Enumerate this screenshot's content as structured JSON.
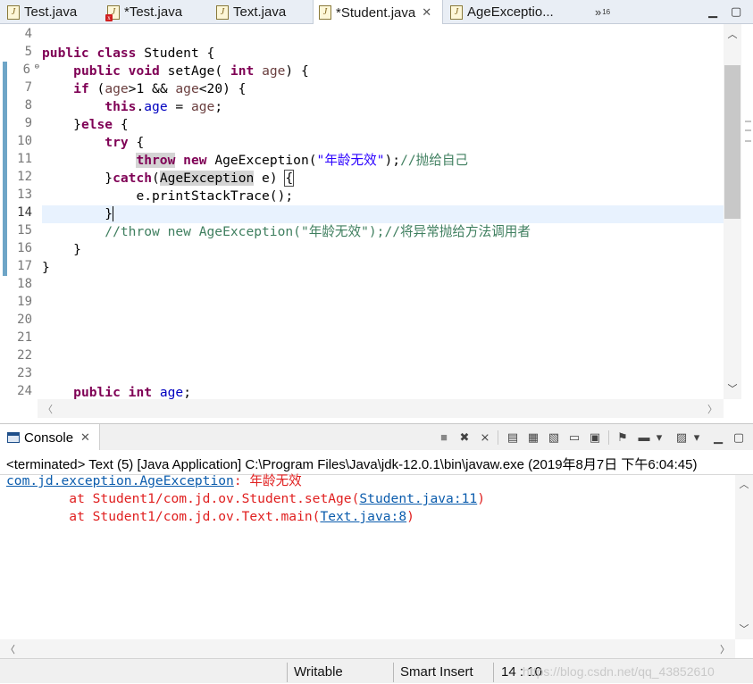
{
  "editor_tabs": [
    {
      "label": "Test.java",
      "icon": "java-file-icon",
      "active": false,
      "error": false
    },
    {
      "label": "*Test.java",
      "icon": "java-file-error-icon",
      "active": false,
      "error": true
    },
    {
      "label": "Text.java",
      "icon": "java-file-icon",
      "active": false,
      "error": false
    },
    {
      "label": "*Student.java",
      "icon": "java-file-icon",
      "active": true,
      "error": false
    },
    {
      "label": "AgeExceptio...",
      "icon": "java-file-icon",
      "active": false,
      "error": false
    }
  ],
  "tab_overflow": {
    "symbol": "»",
    "count": "16"
  },
  "editor": {
    "line_numbers": [
      "4",
      "5",
      "6",
      "7",
      "8",
      "9",
      "10",
      "11",
      "12",
      "13",
      "14",
      "15",
      "16",
      "17",
      "18",
      "19",
      "20",
      "21",
      "22",
      "23",
      "24"
    ],
    "current_line": "14",
    "code": {
      "l5": [
        "public",
        "class",
        " Student {"
      ],
      "l6": [
        "public",
        "void",
        " setAge( ",
        "int",
        "age",
        ") {"
      ],
      "l7": [
        "if",
        " (",
        "age",
        ">1 && ",
        "age",
        "<20) {"
      ],
      "l8": [
        "this",
        ".",
        "age",
        " = ",
        "age",
        ";"
      ],
      "l9": [
        "}",
        "else",
        " {"
      ],
      "l10": [
        "try",
        " {"
      ],
      "l11": [
        "throw",
        "new",
        " AgeException(",
        "\"年龄无效\"",
        ");",
        "//抛给自己"
      ],
      "l12": [
        "}",
        "catch",
        "(",
        "AgeException",
        " e) ",
        "{"
      ],
      "l13": [
        "e.printStackTrace();"
      ],
      "l14": [
        "}"
      ],
      "l15": [
        "//throw new AgeException(\"年龄无效\");//将异常抛给方法调用者"
      ],
      "l16": [
        "}"
      ],
      "l17": [
        "}"
      ],
      "l24": [
        "public",
        "int",
        "age",
        ";"
      ]
    }
  },
  "console": {
    "tab_label": "Console",
    "terminated_line": "<terminated> Text (5) [Java Application] C:\\Program Files\\Java\\jdk-12.0.1\\bin\\javaw.exe (2019年8月7日 下午6:04:45)",
    "output": {
      "exception_class": "com.jd.exception.AgeException",
      "exception_sep": ": ",
      "exception_message": "年龄无效",
      "frames": [
        {
          "prefix": "        at Student1/com.jd.ov.Student.setAge(",
          "link": "Student.java:11",
          "suffix": ")"
        },
        {
          "prefix": "        at Student1/com.jd.ov.Text.main(",
          "link": "Text.java:8",
          "suffix": ")"
        }
      ]
    },
    "toolbar_icons": [
      "terminate-icon",
      "remove-launch-icon",
      "remove-all-terminated-icon",
      "clear-console-icon",
      "scroll-lock-icon",
      "word-wrap-icon",
      "show-on-output-icon",
      "show-on-error-icon",
      "pin-console-icon",
      "display-console-icon",
      "open-console-icon",
      "minimize-icon",
      "maximize-icon"
    ]
  },
  "status_bar": {
    "mode": "Writable",
    "insert": "Smart Insert",
    "position": "14 : 10",
    "watermark": "https://blog.csdn.net/qq_43852610"
  }
}
